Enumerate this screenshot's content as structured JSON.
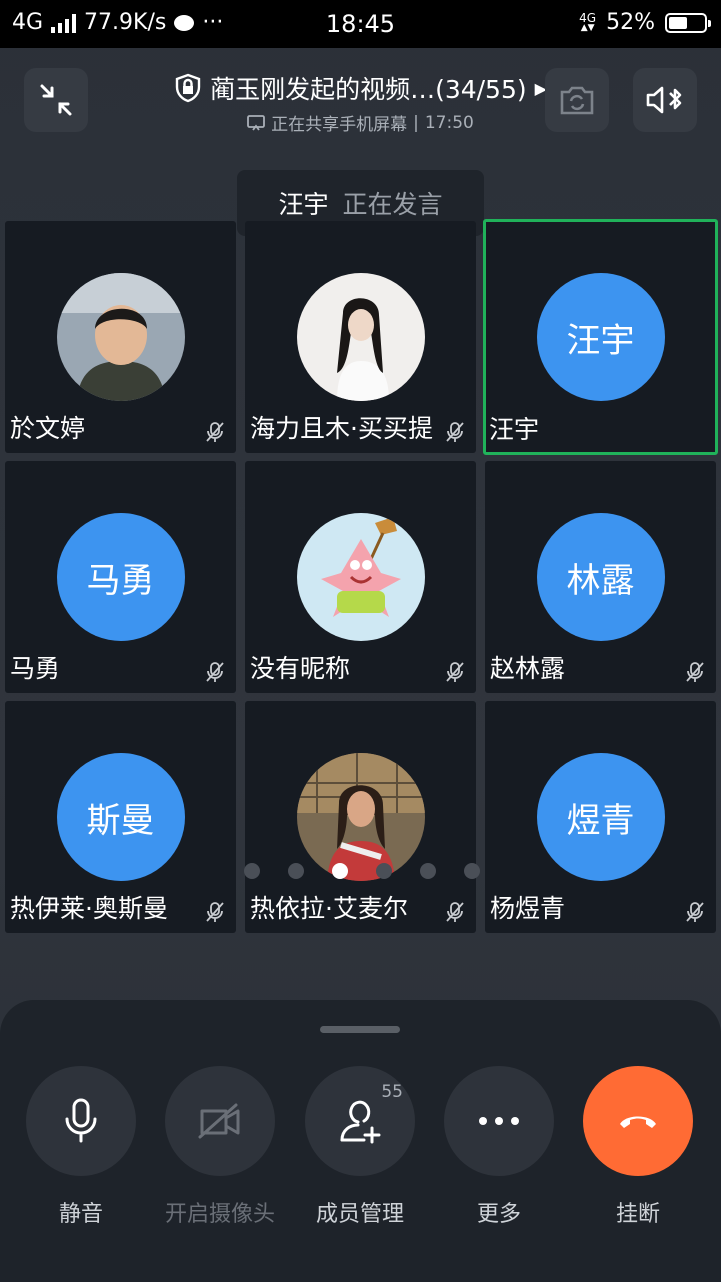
{
  "status_bar": {
    "network": "4G",
    "speed": "77.9K/s",
    "more": "···",
    "time": "18:45",
    "net_small": "4G",
    "battery_text": "52%",
    "battery_level": 0.52
  },
  "header": {
    "title": "蔺玉刚发起的视频…(34/55)",
    "subtitle_status": "正在共享手机屏幕",
    "subtitle_sep": "|",
    "subtitle_time": "17:50"
  },
  "speaking": {
    "name": "汪宇",
    "status": "正在发言"
  },
  "participants": [
    {
      "name": "於文婷",
      "avatar_text": "",
      "muted": true
    },
    {
      "name": "海力且木·买买提",
      "avatar_text": "",
      "muted": true
    },
    {
      "name": "汪宇",
      "avatar_text": "汪宇",
      "muted": false,
      "speaking": true
    },
    {
      "name": "马勇",
      "avatar_text": "马勇",
      "muted": true
    },
    {
      "name": "没有昵称",
      "avatar_text": "",
      "muted": true
    },
    {
      "name": "赵林露",
      "avatar_text": "林露",
      "muted": true
    },
    {
      "name": "热伊莱·奥斯曼",
      "avatar_text": "斯曼",
      "muted": true
    },
    {
      "name": "热依拉·艾麦尔",
      "avatar_text": "",
      "muted": true
    },
    {
      "name": "杨煜青",
      "avatar_text": "煜青",
      "muted": true
    }
  ],
  "pager": {
    "pages": 6,
    "current_page": 3
  },
  "controls": {
    "mute": "静音",
    "camera": "开启摄像头",
    "members": "成员管理",
    "members_count": "55",
    "more": "更多",
    "hangup": "挂断"
  },
  "colors": {
    "accent_blue": "#3d94f0",
    "speaking_green": "#20b25a",
    "hangup_orange": "#ff6b34"
  }
}
